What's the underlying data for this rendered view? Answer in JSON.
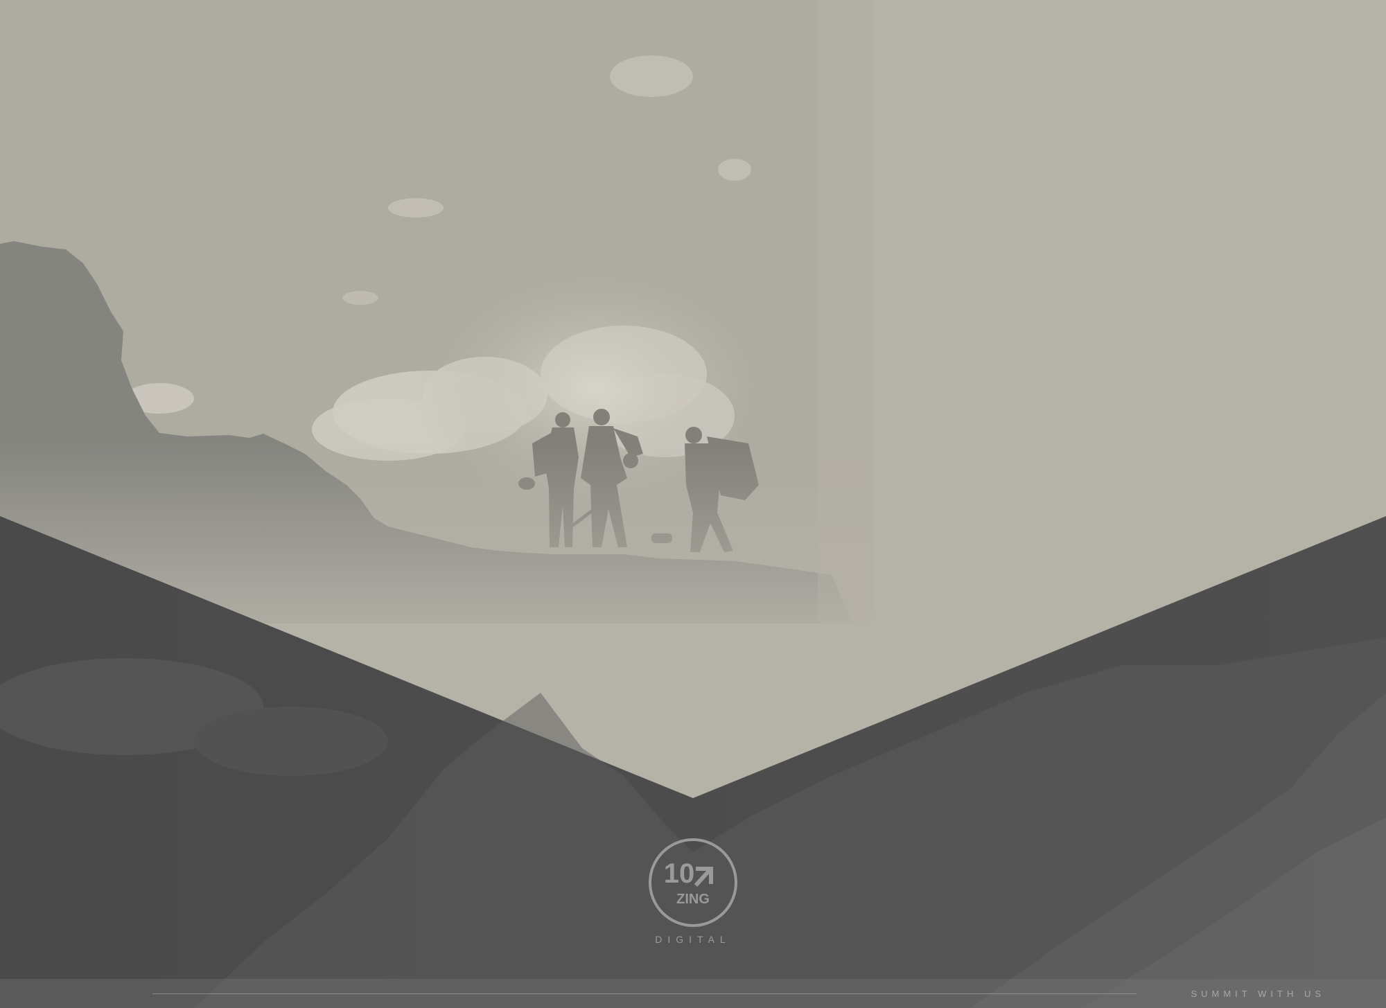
{
  "brand": {
    "logo_number": "10",
    "logo_name": "ZING",
    "wordmark": "DIGITAL"
  },
  "footer": {
    "tagline": "SUMMIT WITH US"
  },
  "colors": {
    "sky": "#b5b2a8",
    "dark_band": "#4f4f4f",
    "mountain_silhouette": "#858580",
    "logo_stroke": "#9a9a9a"
  },
  "icons": {
    "logo": "zing-digital-logo-icon",
    "arrow": "arrow-up-right-icon"
  }
}
